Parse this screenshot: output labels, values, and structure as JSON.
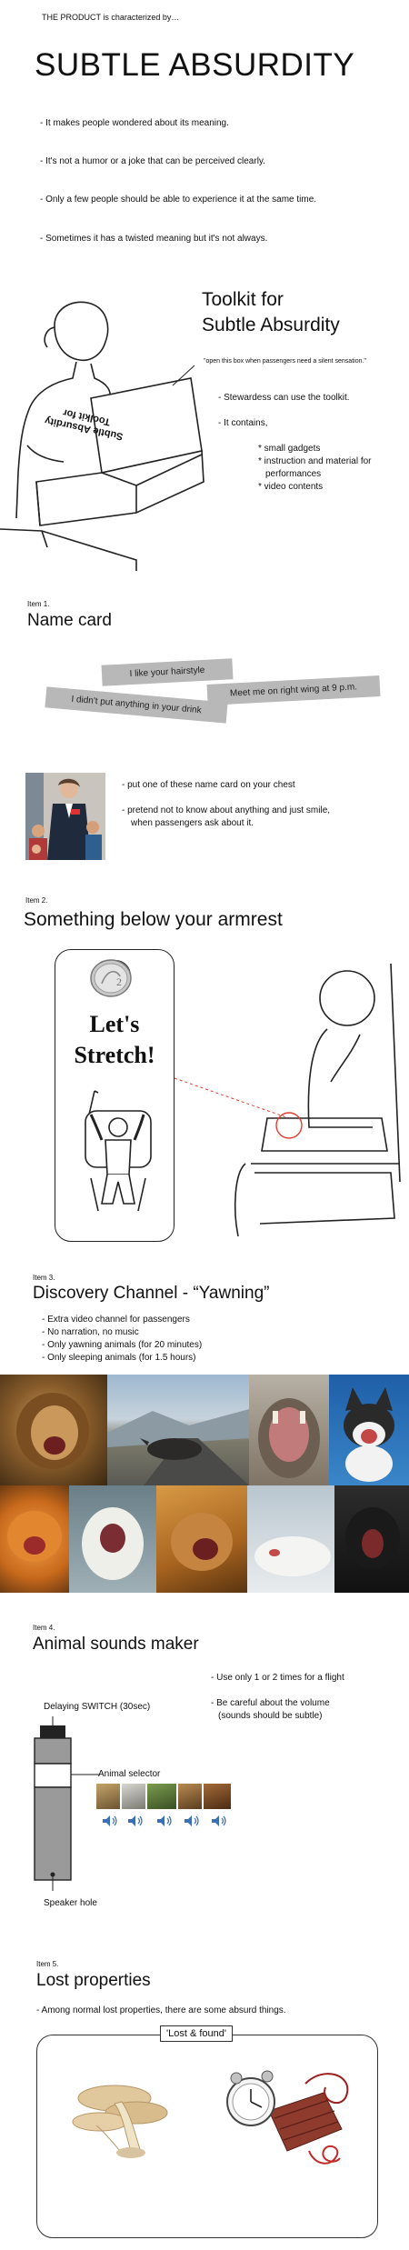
{
  "intro": {
    "lead": "THE PRODUCT is characterized by…",
    "title": "SUBTLE ABSURDITY",
    "points": [
      "- It makes people wondered about its meaning.",
      "- It's not a humor or a joke that can be perceived clearly.",
      "- Only a few people should be able to experience it at the same time.",
      "- Sometimes it has a twisted meaning but it's not always."
    ]
  },
  "toolkit": {
    "title_line1": "Toolkit for",
    "title_line2": "Subtle Absurdity",
    "note": "\"open this box when passengers need a silent sensation.\"",
    "box_text_line1": "Toolkit for",
    "box_text_line2": "Subtle Absurdity",
    "bullet1": "- Stewardess can use the toolkit.",
    "bullet2": "- It contains,",
    "sub1": "* small gadgets",
    "sub2": "* instruction and material for",
    "sub2b": "performances",
    "sub3": "* video contents"
  },
  "item1": {
    "label": "Item 1.",
    "title": "Name card",
    "tags": [
      "I like your hairstyle",
      "Meet me on right wing at 9 p.m.",
      "I didn't put anything in your drink"
    ],
    "bullet1": "- put one of these name card on your chest",
    "bullet2_line1": "- pretend not to know about anything and just smile,",
    "bullet2_line2": "when passengers ask about it."
  },
  "item2": {
    "label": "Item 2.",
    "title": "Something below your armrest",
    "card_line1": "Let's",
    "card_line2": "Stretch!"
  },
  "item3": {
    "label": "Item 3.",
    "title": "Discovery Channel - “Yawning”",
    "points": [
      "- Extra video channel for passengers",
      "- No narration, no music",
      "- Only yawning animals (for 20 minutes)",
      "- Only sleeping animals (for 1.5 hours)"
    ]
  },
  "item4": {
    "label": "Item 4.",
    "title": "Animal sounds maker",
    "bullet1": "- Use only 1 or 2 times for a flight",
    "bullet2_line1": "- Be careful about the volume",
    "bullet2_line2": "(sounds should be subtle)",
    "switch_label": "Delaying SWITCH (30sec)",
    "selector_label": "Animal selector",
    "speaker_label": "Speaker hole"
  },
  "item5": {
    "label": "Item 5.",
    "title": "Lost properties",
    "description": "- Among normal lost properties, there are some absurd things.",
    "box_label": "'Lost & found'"
  },
  "colors": {
    "tag_gray": "#b8b8b8",
    "accent_red": "#e23b2e"
  }
}
